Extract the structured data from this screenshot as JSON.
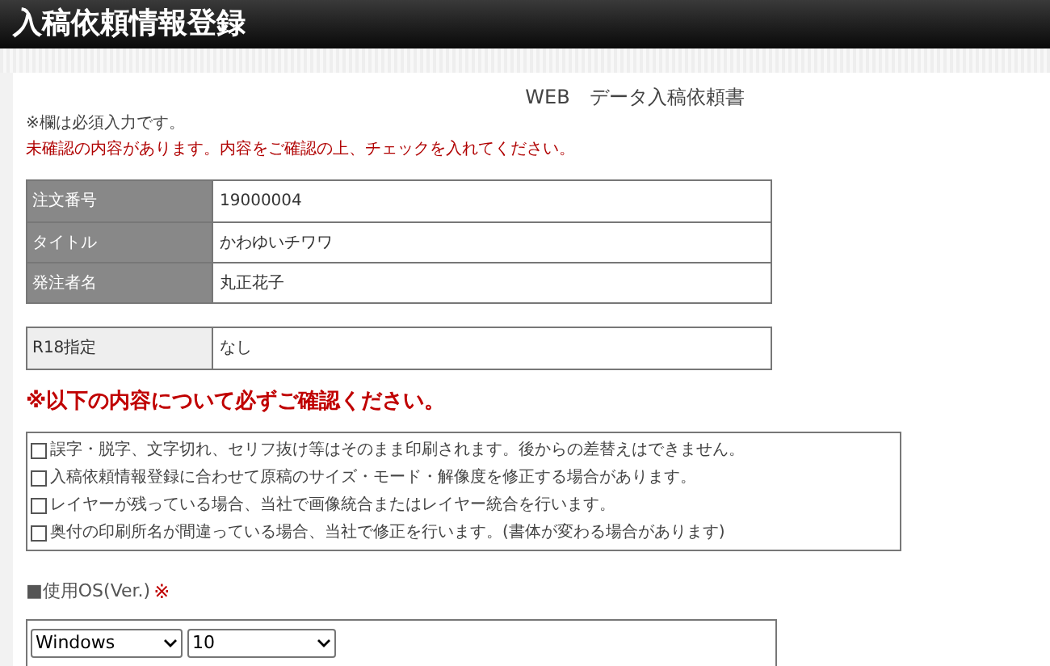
{
  "header": {
    "title": "入稿依頼情報登録"
  },
  "form_title": "WEB　データ入稿依頼書",
  "notes": [
    {
      "text": "※欄は必須入力です。",
      "kind": "info"
    },
    {
      "text": "未確認の内容があります。内容をご確認の上、チェックを入れてください。",
      "kind": "error"
    }
  ],
  "order_table": [
    {
      "label": "注文番号",
      "value": "19000004"
    },
    {
      "label": "タイトル",
      "value": "かわゆいチワワ"
    },
    {
      "label": "発注者名",
      "value": "丸正花子"
    }
  ],
  "r18_table": [
    {
      "label": "R18指定",
      "value": "なし"
    }
  ],
  "confirm_heading": "※以下の内容について必ずご確認ください。",
  "confirm_items": [
    {
      "label": "誤字・脱字、文字切れ、セリフ抜け等はそのまま印刷されます。後からの差替えはできません。",
      "checked": false
    },
    {
      "label": "入稿依頼情報登録に合わせて原稿のサイズ・モード・解像度を修正する場合があります。",
      "checked": false
    },
    {
      "label": "レイヤーが残っている場合、当社で画像統合またはレイヤー統合を行います。",
      "checked": false
    },
    {
      "label": "奥付の印刷所名が間違っている場合、当社で修正を行います。(書体が変わる場合があります)",
      "checked": false
    }
  ],
  "os_section": {
    "label": "■使用OS(Ver.)",
    "required_mark": "※",
    "selects": [
      {
        "value": "Windows"
      },
      {
        "value": "10"
      }
    ]
  }
}
